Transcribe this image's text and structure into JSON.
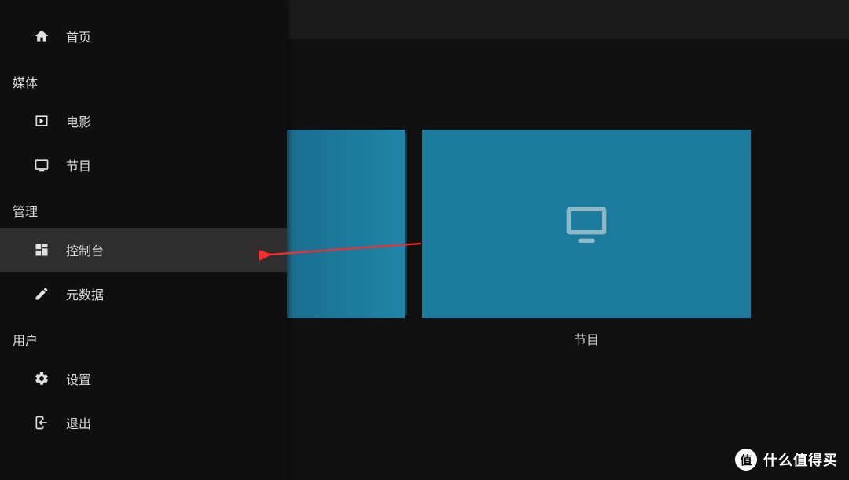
{
  "sidebar": {
    "items": [
      {
        "label": "首页",
        "icon": "home-icon"
      }
    ],
    "sections": [
      {
        "title": "媒体",
        "items": [
          {
            "label": "电影",
            "icon": "movie-icon"
          },
          {
            "label": "节目",
            "icon": "tv-icon"
          }
        ]
      },
      {
        "title": "管理",
        "items": [
          {
            "label": "控制台",
            "icon": "dashboard-icon",
            "active": true
          },
          {
            "label": "元数据",
            "icon": "pencil-icon"
          }
        ]
      },
      {
        "title": "用户",
        "items": [
          {
            "label": "设置",
            "icon": "gear-icon"
          },
          {
            "label": "退出",
            "icon": "exit-icon"
          }
        ]
      }
    ]
  },
  "content": {
    "cards": [
      {
        "label": "",
        "partial": true
      },
      {
        "label": "节目",
        "icon": "tv-big-icon"
      }
    ]
  },
  "watermark": {
    "badge": "值",
    "text": "什么值得买"
  },
  "colors": {
    "card_bg": "#1c7a9c",
    "sidebar_bg": "#0f0f0f",
    "active_bg": "#2e2e2e",
    "arrow": "#ff2a2a"
  }
}
